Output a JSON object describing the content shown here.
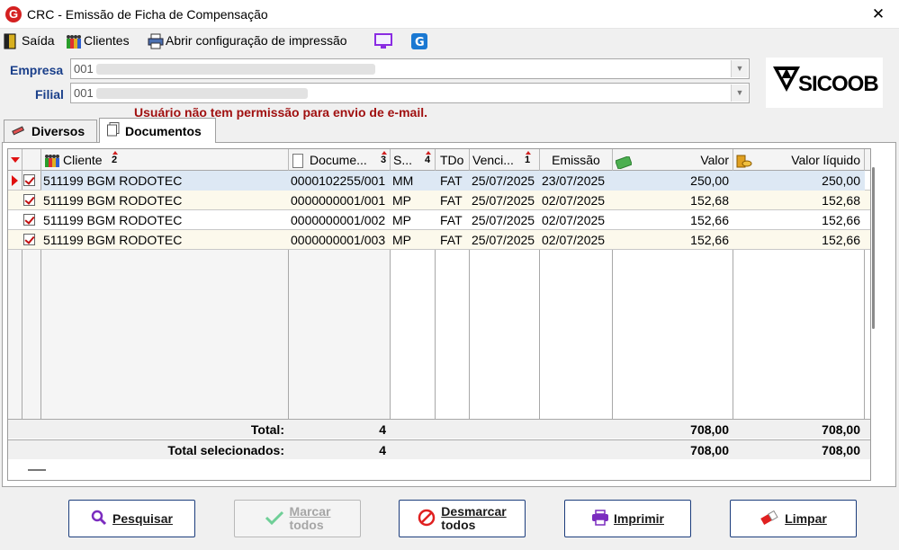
{
  "window": {
    "title": "CRC - Emissão de Ficha de Compensação",
    "close_label": "✕"
  },
  "toolbar": {
    "saida": "Saída",
    "clientes": "Clientes",
    "abrir": "Abrir configuração de impressão"
  },
  "form": {
    "empresa_label": "Empresa",
    "empresa_value": "001",
    "filial_label": "Filial",
    "filial_value": "001",
    "warning": "Usuário não tem permissão para envio de e-mail."
  },
  "logo": {
    "text": "SICOOB"
  },
  "tabs": [
    "Diversos",
    "Documentos"
  ],
  "grid": {
    "headers": {
      "cliente": "Cliente",
      "cliente_sort": "2",
      "documento": "Docume...",
      "documento_sort": "3",
      "s": "S...",
      "s_sort": "4",
      "tdo": "TDo",
      "venc": "Venci...",
      "venc_sort": "1",
      "emissao": "Emissão",
      "valor": "Valor",
      "valor_liquido": "Valor líquido"
    },
    "rows": [
      {
        "cliente": "511199 BGM RODOTEC",
        "documento": "0000102255/001",
        "s": "MM",
        "tdo": "FAT",
        "venc": "25/07/2025",
        "emissao": "23/07/2025",
        "valor": "250,00",
        "valor_liquido": "250,00"
      },
      {
        "cliente": "511199 BGM RODOTEC",
        "documento": "0000000001/001",
        "s": "MP",
        "tdo": "FAT",
        "venc": "25/07/2025",
        "emissao": "02/07/2025",
        "valor": "152,68",
        "valor_liquido": "152,68"
      },
      {
        "cliente": "511199 BGM RODOTEC",
        "documento": "0000000001/002",
        "s": "MP",
        "tdo": "FAT",
        "venc": "25/07/2025",
        "emissao": "02/07/2025",
        "valor": "152,66",
        "valor_liquido": "152,66"
      },
      {
        "cliente": "511199 BGM RODOTEC",
        "documento": "0000000001/003",
        "s": "MP",
        "tdo": "FAT",
        "venc": "25/07/2025",
        "emissao": "02/07/2025",
        "valor": "152,66",
        "valor_liquido": "152,66"
      }
    ],
    "total": {
      "label": "Total:",
      "count": "4",
      "valor": "708,00",
      "valor_liquido": "708,00"
    },
    "total_sel": {
      "label": "Total selecionados:",
      "count": "4",
      "valor": "708,00",
      "valor_liquido": "708,00"
    }
  },
  "buttons": {
    "pesquisar": "Pesquisar",
    "marcar_1": "Marcar",
    "marcar_2": "todos",
    "desmarcar_1": "Desmarcar",
    "desmarcar_2": "todos",
    "imprimir": "Imprimir",
    "limpar": "Limpar"
  },
  "colors": {
    "accent_blue": "#1a3f8a",
    "warning_red": "#a01010",
    "check_red": "#c01010",
    "row_alt": "#fcf9ec",
    "row_selected": "#dde8f4"
  }
}
